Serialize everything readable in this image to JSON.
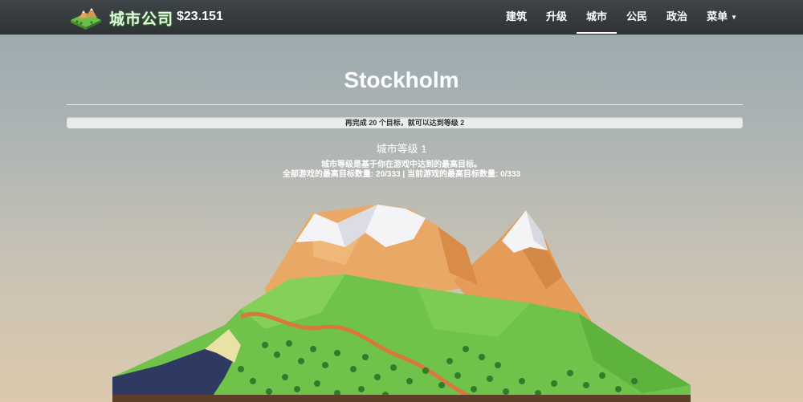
{
  "header": {
    "brand_name": "城市公司",
    "money": "$23.151",
    "nav": [
      {
        "label": "建筑"
      },
      {
        "label": "升级"
      },
      {
        "label": "城市",
        "active": true
      },
      {
        "label": "公民"
      },
      {
        "label": "政治"
      },
      {
        "label": "菜单"
      }
    ]
  },
  "city": {
    "name": "Stockholm",
    "progress_text": "再完成 20 个目标，就可以达到等级 2",
    "progress_value": 0,
    "level_title": "城市等级 1",
    "level_desc": "城市等级是基于你在游戏中达到的最高目标。",
    "goals_line": "全部游戏的最高目标数量: 20/333 | 当前游戏的最高目标数量: 0/333"
  },
  "colors": {
    "navbar": "#2f3336",
    "snow": "#f4f4f6",
    "rock": "#e8a862",
    "grass": "#6fc24a",
    "water": "#2f3a63",
    "road": "#d9773c",
    "soil": "#5b3f28"
  }
}
